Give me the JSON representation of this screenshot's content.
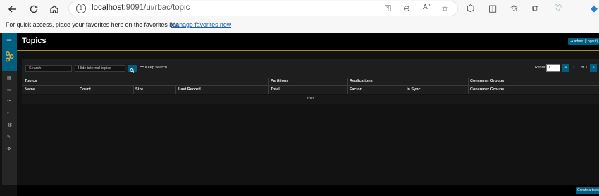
{
  "browser": {
    "url_host": "localhost",
    "url_path": ":9091/ui/rbac/topic",
    "favorites_text": "For quick access, place your favorites here on the favorites bar.",
    "favorites_link": "Manage favorites now",
    "icons": [
      "back-arrow-icon",
      "refresh-icon",
      "home-icon",
      "info-icon",
      "key-icon",
      "zoom-icon",
      "read-aloud-icon",
      "star-icon",
      "extensions-icon",
      "split-screen-icon",
      "favorites-icon",
      "collections-icon",
      "browser-essentials-icon",
      "copilot-icon"
    ]
  },
  "app": {
    "title": "Topics",
    "admin_label": "admin (Logout)",
    "sidebar_icons": [
      "menu-icon",
      "logo-icon",
      "nodes-icon",
      "topics-icon",
      "list-icon",
      "consumer-icon",
      "acls-icon",
      "schema-icon",
      "settings-icon"
    ]
  },
  "toolbar": {
    "search_placeholder": "Search",
    "topics_filter": "Hide internal topics",
    "keep_search": "Keep search",
    "results_label": "Results",
    "results_value": "1",
    "page_prev": "«",
    "page_current": "1",
    "page_of": "of 1",
    "page_next": "»"
  },
  "table": {
    "group_headers": [
      "Topics",
      "Partitions",
      "Replications",
      "Consumer Groups"
    ],
    "columns": [
      "Name",
      "Count",
      "Size",
      "Last Record",
      "Total",
      "Factor",
      "In Sync",
      "Consumer Groups"
    ],
    "empty_text": "*****"
  },
  "footer": {
    "create_label": "Create a topic"
  },
  "colors": {
    "accent": "#005f81",
    "header_underline": "#b0892b",
    "background": "#121212"
  }
}
